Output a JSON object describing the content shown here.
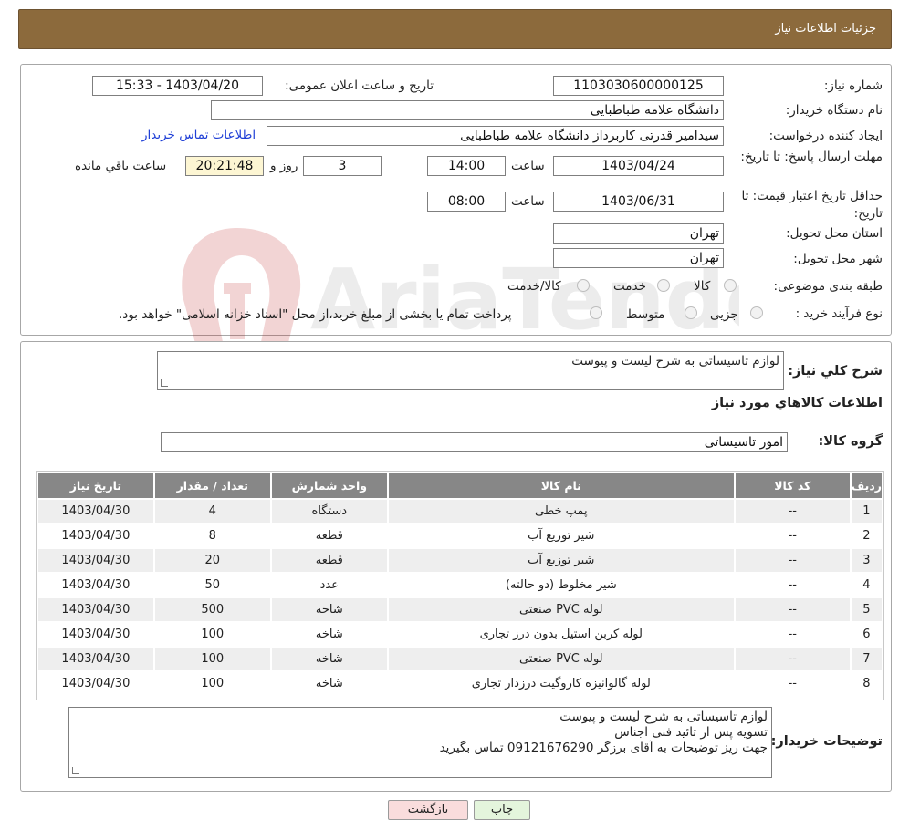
{
  "header": {
    "title": "جزئیات اطلاعات نیاز"
  },
  "form": {
    "need_number_label": "شماره نیاز:",
    "need_number": "1103030600000125",
    "announce_label": "تاریخ و ساعت اعلان عمومی:",
    "announce_value": "1403/04/20 - 15:33",
    "buyer_org_label": "نام دستگاه خریدار:",
    "buyer_org": "دانشگاه علامه طباطبایی",
    "creator_label": "ایجاد کننده درخواست:",
    "creator": "سیدامیر قدرتی کاربرداز دانشگاه علامه طباطبایی",
    "contact_link": "اطلاعات تماس خریدار",
    "deadline_label": "مهلت ارسال پاسخ: تا تاریخ:",
    "deadline_date": "1403/04/24",
    "time_label": "ساعت",
    "deadline_time": "14:00",
    "days_value": "3",
    "days_label": "روز و",
    "remaining_time": "20:21:48",
    "remaining_label": "ساعت باقي مانده",
    "validity_label": "حداقل تاریخ اعتبار قیمت: تا تاریخ:",
    "validity_date": "1403/06/31",
    "validity_time": "08:00",
    "province_label": "استان محل تحویل:",
    "province": "تهران",
    "city_label": "شهر محل تحویل:",
    "city": "تهران",
    "category_label": "طبقه بندی موضوعی:",
    "category_options": [
      "کالا",
      "خدمت",
      "کالا/خدمت"
    ],
    "process_label": "نوع فرآیند خرید :",
    "process_options": [
      "جزیی",
      "متوسط"
    ],
    "process_note": "پرداخت تمام یا بخشی از مبلغ خرید،از محل \"اسناد خزانه اسلامی\" خواهد بود."
  },
  "watermark": {
    "text": "AriaTender.neT"
  },
  "summary": {
    "label": "شرح کلي نیاز:",
    "value": "لوازم تاسیساتی به شرح لیست و پیوست",
    "goods_info_title": "اطلاعات کالاهاي مورد نیاز",
    "group_label": "گروه کالا:",
    "group_value": "امور تاسیساتی"
  },
  "table": {
    "headers": [
      "ردیف",
      "کد کالا",
      "نام کالا",
      "واحد شمارش",
      "تعداد / مقدار",
      "تاریخ نیاز"
    ],
    "rows": [
      [
        "1",
        "--",
        "پمپ خطی",
        "دستگاه",
        "4",
        "1403/04/30"
      ],
      [
        "2",
        "--",
        "شیر توزیع آب",
        "قطعه",
        "8",
        "1403/04/30"
      ],
      [
        "3",
        "--",
        "شیر توزیع آب",
        "قطعه",
        "20",
        "1403/04/30"
      ],
      [
        "4",
        "--",
        "شیر مخلوط (دو حالته)",
        "عدد",
        "50",
        "1403/04/30"
      ],
      [
        "5",
        "--",
        "لوله PVC صنعتی",
        "شاخه",
        "500",
        "1403/04/30"
      ],
      [
        "6",
        "--",
        "لوله کربن استیل بدون درز تجاری",
        "شاخه",
        "100",
        "1403/04/30"
      ],
      [
        "7",
        "--",
        "لوله PVC صنعتی",
        "شاخه",
        "100",
        "1403/04/30"
      ],
      [
        "8",
        "--",
        "لوله گالوانیزه کاروگیت درزدار تجاری",
        "شاخه",
        "100",
        "1403/04/30"
      ]
    ]
  },
  "buyer_notes": {
    "label": "توضیحات خریدار:",
    "lines": [
      "لوازم تاسیساتی به شرح لیست و پیوست",
      "تسویه پس از تائید فنی اجناس",
      "جهت ریز توضیحات به آقای برزگر 09121676290 تماس بگیرید"
    ]
  },
  "buttons": {
    "print": "چاپ",
    "back": "بازگشت"
  },
  "colors": {
    "header": "#8c6a3c",
    "table_header": "#878787",
    "link": "#1f3fd6",
    "back_button": "#f9dcdc",
    "print_button": "#e4f5dc",
    "remaining_bg": "#fdf6d3"
  }
}
